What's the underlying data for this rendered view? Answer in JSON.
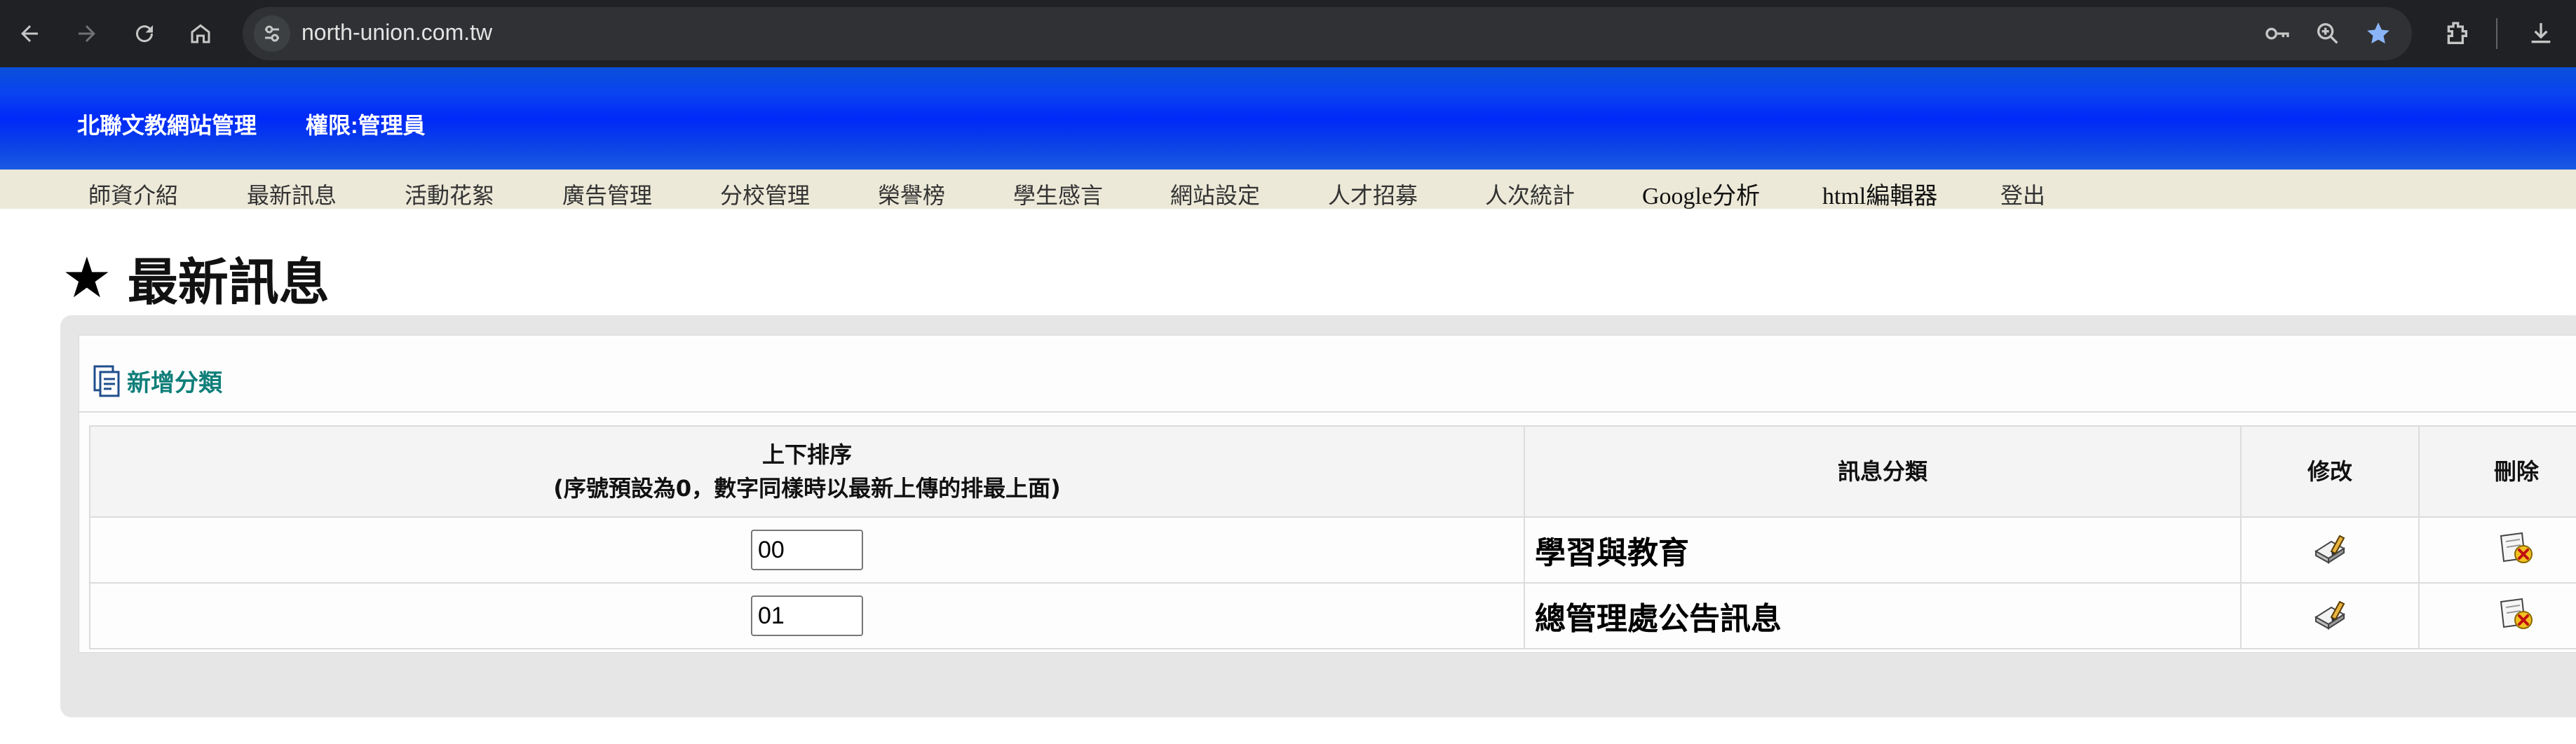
{
  "browser": {
    "url": "north-union.com.tw",
    "icons": [
      "back-arrow-icon",
      "forward-arrow-icon",
      "reload-icon",
      "home-icon",
      "site-settings-icon",
      "password-key-icon",
      "zoom-icon",
      "bookmark-star-icon",
      "extensions-icon",
      "download-icon"
    ]
  },
  "header": {
    "title": "北聯文教網站管理",
    "role": "權限:管理員",
    "brand_color": "#0a40e8"
  },
  "menu": {
    "items": [
      {
        "label": "師資介紹"
      },
      {
        "label": "最新訊息"
      },
      {
        "label": "活動花絮"
      },
      {
        "label": "廣告管理"
      },
      {
        "label": "分校管理"
      },
      {
        "label": "榮譽榜"
      },
      {
        "label": "學生感言"
      },
      {
        "label": "網站設定"
      },
      {
        "label": "人才招募"
      },
      {
        "label": "人次統計"
      },
      {
        "label": "Google分析"
      },
      {
        "label": "html編輯器"
      },
      {
        "label": "登出"
      }
    ]
  },
  "page": {
    "title": "最新訊息",
    "add_category_label": "新增分類"
  },
  "table": {
    "headers": {
      "sort_line1": "上下排序",
      "sort_line2": "(序號預設為0，數字同樣時以最新上傳的排最上面)",
      "category": "訊息分類",
      "edit": "修改",
      "delete": "刪除"
    },
    "rows": [
      {
        "sort": "00",
        "category": "學習與教育"
      },
      {
        "sort": "01",
        "category": "總管理處公告訊息"
      }
    ]
  }
}
